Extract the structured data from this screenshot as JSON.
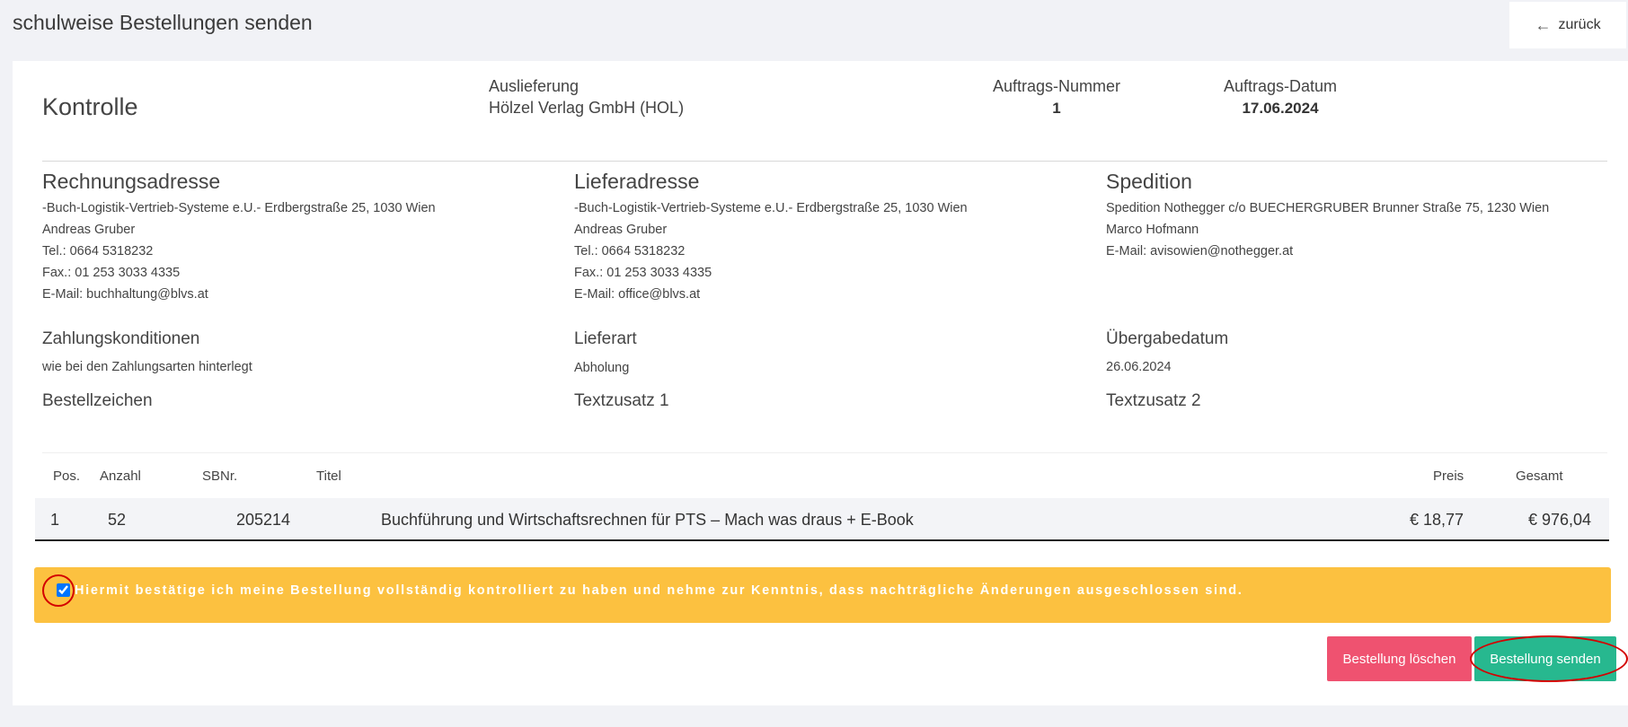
{
  "header": {
    "title": "schulweise Bestellungen senden",
    "back_label": "zurück"
  },
  "summary": {
    "heading": "Kontrolle",
    "auslieferung_label": "Auslieferung",
    "auslieferung_value": "Hölzel Verlag GmbH (HOL)",
    "auftragsnummer_label": "Auftrags-Nummer",
    "auftragsnummer_value": "1",
    "auftragsdatum_label": "Auftrags-Datum",
    "auftragsdatum_value": "17.06.2024"
  },
  "rechnung": {
    "title": "Rechnungsadresse",
    "lines": [
      "-Buch-Logistik-Vertrieb-Systeme e.U.- Erdbergstraße 25, 1030 Wien",
      "Andreas Gruber",
      "Tel.: 0664 5318232",
      "Fax.: 01 253 3033 4335",
      "E-Mail: buchhaltung@blvs.at"
    ]
  },
  "liefer": {
    "title": "Lieferadresse",
    "lines": [
      "-Buch-Logistik-Vertrieb-Systeme e.U.- Erdbergstraße 25, 1030 Wien",
      "Andreas Gruber",
      "Tel.: 0664 5318232",
      "Fax.: 01 253 3033 4335",
      "E-Mail: office@blvs.at"
    ]
  },
  "spedition": {
    "title": "Spedition",
    "lines": [
      "Spedition Nothegger c/o BUECHERGRUBER Brunner Straße 75, 1230 Wien",
      "Marco Hofmann",
      "E-Mail: avisowien@nothegger.at"
    ]
  },
  "details": {
    "zahlung_label": "Zahlungskonditionen",
    "zahlung_value": "wie bei den Zahlungsarten hinterlegt",
    "lieferart_label": "Lieferart",
    "lieferart_value": "Abholung",
    "uebergabe_label": "Übergabedatum",
    "uebergabe_value": "26.06.2024",
    "bestellzeichen_label": "Bestellzeichen",
    "textzusatz1_label": "Textzusatz 1",
    "textzusatz2_label": "Textzusatz 2"
  },
  "table": {
    "headers": {
      "pos": "Pos.",
      "anzahl": "Anzahl",
      "sbnr": "SBNr.",
      "titel": "Titel",
      "preis": "Preis",
      "gesamt": "Gesamt"
    },
    "rows": [
      {
        "pos": "1",
        "anzahl": "52",
        "sbnr": "205214",
        "titel": "Buchführung und Wirtschaftsrechnen für PTS – Mach was draus + E-Book",
        "preis": "€ 18,77",
        "gesamt": "€ 976,04"
      }
    ]
  },
  "confirm": {
    "checked": true,
    "text": "Hiermit bestätige ich meine Bestellung vollständig kontrolliert zu haben und nehme zur Kenntnis, dass nachträgliche Änderungen ausgeschlossen sind."
  },
  "actions": {
    "delete_label": "Bestellung löschen",
    "send_label": "Bestellung senden"
  },
  "colors": {
    "warning": "#fcc140",
    "danger": "#ef5270",
    "success": "#27b88f",
    "highlight_ring": "#d40000"
  }
}
